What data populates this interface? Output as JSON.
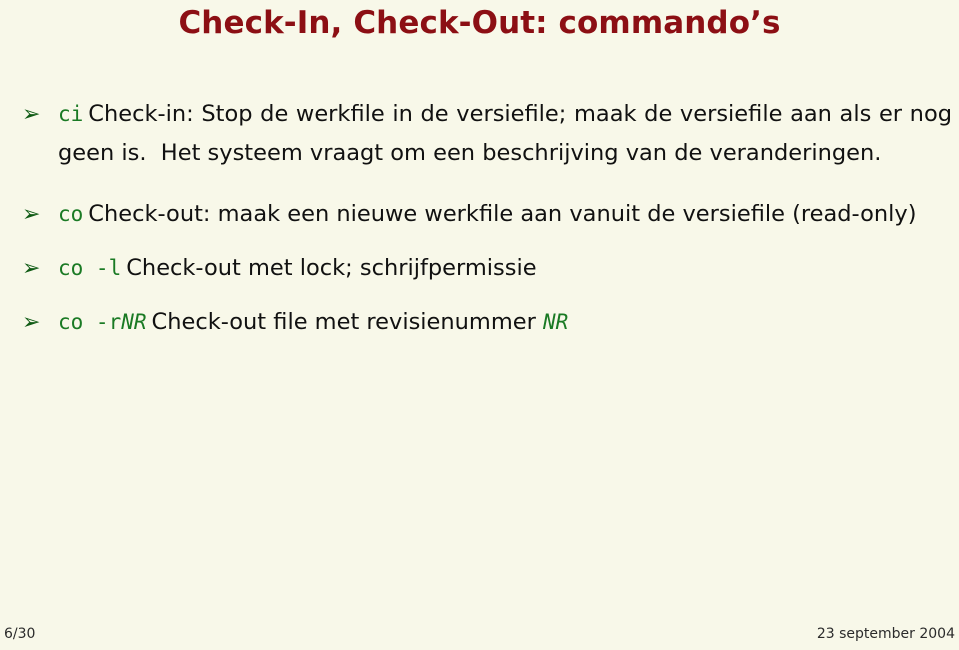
{
  "slide": {
    "title": "Check-In, Check-Out: commando’s",
    "background_color": "#f8f8e9",
    "title_color": "#8c0f14",
    "body_text_color": "#111111",
    "code_color": "#1a7a24",
    "bullet_glyph": "➢",
    "bullet_color": "#0f5a14"
  },
  "bullets": [
    {
      "marker": "➢",
      "command": "ci",
      "text_part_1": "Check-in: Stop de werkfile in de versiefile; maak de versiefile aan als er nog geen is.  Het systeem vraagt om een beschrijving van de veranderingen."
    },
    {
      "marker": "➢",
      "command": "co",
      "text_part_1": "Check-out: maak een nieuwe werkfile aan vanuit de versiefile (read-only)"
    },
    {
      "marker": "➢",
      "command": "co -l",
      "text_part_1": "Check-out met lock; schrijfpermissie"
    },
    {
      "marker": "➢",
      "command_prefix": "co -r",
      "command_arg": "NR",
      "text_part_1": "Check-out file met revisienummer ",
      "text_arg": "NR"
    }
  ],
  "footer": {
    "page": "6/30",
    "date": "23 september 2004"
  }
}
